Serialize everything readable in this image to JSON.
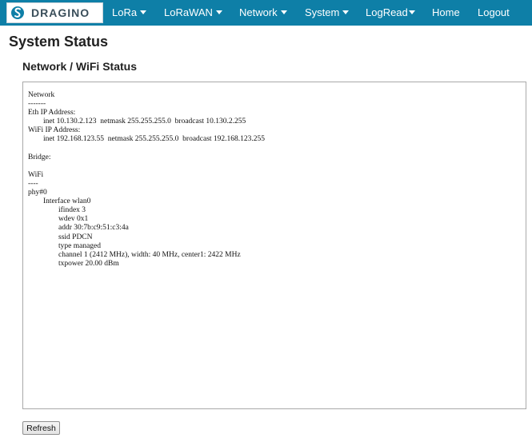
{
  "brand": {
    "name": "DRAGINO"
  },
  "nav": {
    "items": [
      {
        "label": "LoRa",
        "has_menu": true
      },
      {
        "label": "LoRaWAN",
        "has_menu": true
      },
      {
        "label": "Network",
        "has_menu": true
      },
      {
        "label": "System",
        "has_menu": true
      },
      {
        "label": "LogRead",
        "has_menu": true
      },
      {
        "label": "Home",
        "has_menu": false
      },
      {
        "label": "Logout",
        "has_menu": false
      }
    ]
  },
  "page": {
    "title": "System Status",
    "section_title": "Network / WiFi Status",
    "status_output": "Network\n-------\nEth IP Address:\n\tinet 10.130.2.123  netmask 255.255.255.0  broadcast 10.130.2.255\nWiFi IP Address:\n\tinet 192.168.123.55  netmask 255.255.255.0  broadcast 192.168.123.255\n\nBridge:\n\nWiFi\n----\nphy#0\n\tInterface wlan0\n\t\tifindex 3\n\t\twdev 0x1\n\t\taddr 30:7b:c9:51:c3:4a\n\t\tssid PDCN\n\t\ttype managed\n\t\tchannel 1 (2412 MHz), width: 40 MHz, center1: 2422 MHz\n\t\ttxpower 20.00 dBm",
    "refresh_label": "Refresh"
  },
  "colors": {
    "navbar_bg": "#0e7fa7",
    "nav_text": "#ffffff",
    "logo_accent": "#0e7fa7"
  },
  "icons": {
    "logo": "dragino-logo-icon",
    "menu_caret": "caret-down-icon"
  }
}
